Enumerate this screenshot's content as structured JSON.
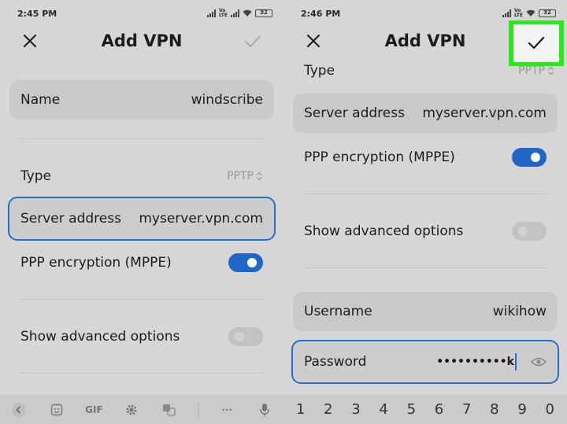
{
  "left": {
    "status_time": "2:45 PM",
    "battery": "32",
    "title": "Add VPN",
    "name_label": "Name",
    "name_value": "windscribe",
    "type_label": "Type",
    "type_value": "PPTP",
    "server_label": "Server address",
    "server_value": "myserver.vpn.com",
    "ppp_label": "PPP encryption (MPPE)",
    "ppp_on": true,
    "advanced_label": "Show advanced options",
    "advanced_on": false
  },
  "right": {
    "status_time": "2:46 PM",
    "battery": "32",
    "title": "Add VPN",
    "type_label": "Type",
    "type_value": "PPTP",
    "server_label": "Server address",
    "server_value": "myserver.vpn.com",
    "ppp_label": "PPP encryption (MPPE)",
    "ppp_on": true,
    "advanced_label": "Show advanced options",
    "advanced_on": false,
    "username_label": "Username",
    "username_value": "wikihow",
    "password_label": "Password",
    "password_value": "••••••••••k"
  },
  "keyboard_toolbar": {
    "gif_label": "GIF",
    "more_label": "···"
  },
  "number_row": [
    "1",
    "2",
    "3",
    "4",
    "5",
    "6",
    "7",
    "8",
    "9",
    "0"
  ],
  "colors": {
    "accent": "#1f66c8",
    "highlight": "#29e81c",
    "background": "#d6d6d6",
    "field": "#c9c9c9"
  },
  "icons": {
    "close": "close-icon",
    "confirm": "checkmark-icon",
    "visibility": "eye-icon",
    "dropdown": "up-down-chevron-icon"
  }
}
